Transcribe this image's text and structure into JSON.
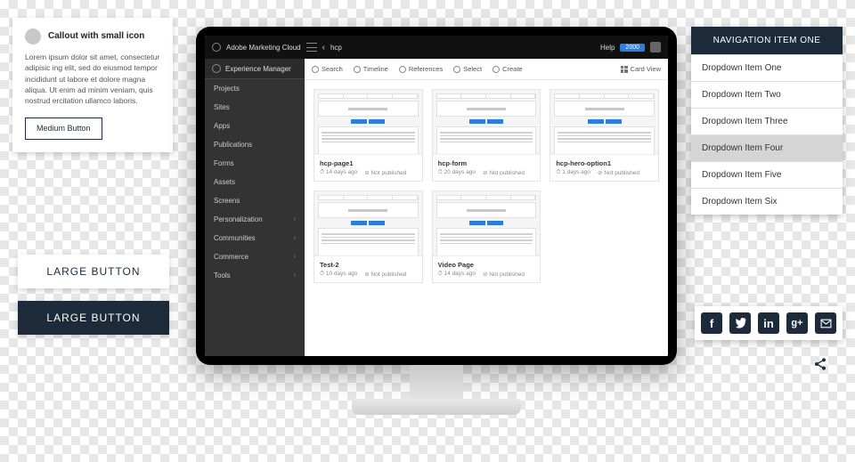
{
  "callout": {
    "title": "Callout with small icon",
    "body": "Lorem ipsum dolor sit amet, consectetur adipisic ing elit, sed do eiusmod tempor incididunt ut labore et dolore magna aliqua. Ut enim ad minim veniam, quis nostrud ercitation ullamco laboris.",
    "button": "Medium Button"
  },
  "large_buttons": {
    "light": "LARGE BUTTON",
    "dark": "LARGE BUTTON"
  },
  "topbar": {
    "brand": "Adobe Marketing Cloud",
    "crumb": "hcp",
    "help": "Help",
    "badge": "2000"
  },
  "sidenav": {
    "brand": "Experience Manager",
    "items": [
      {
        "label": "Projects",
        "expand": false
      },
      {
        "label": "Sites",
        "expand": false
      },
      {
        "label": "Apps",
        "expand": false
      },
      {
        "label": "Publications",
        "expand": false
      },
      {
        "label": "Forms",
        "expand": false
      },
      {
        "label": "Assets",
        "expand": false
      },
      {
        "label": "Screens",
        "expand": false
      },
      {
        "label": "Personalization",
        "expand": true
      },
      {
        "label": "Communities",
        "expand": true
      },
      {
        "label": "Commerce",
        "expand": true
      },
      {
        "label": "Tools",
        "expand": true
      }
    ]
  },
  "toolbar": {
    "items": [
      "Search",
      "Timeline",
      "References",
      "Select",
      "Create"
    ],
    "view": "Card View"
  },
  "cards": [
    {
      "name": "hcp-page1",
      "age": "14 days ago",
      "status": "Not published"
    },
    {
      "name": "hcp-form",
      "age": "20 days ago",
      "status": "Not published"
    },
    {
      "name": "hcp-hero-option1",
      "age": "1 days ago",
      "status": "Not published"
    },
    {
      "name": "Test-2",
      "age": "10 days ago",
      "status": "Not published"
    },
    {
      "name": "Video Page",
      "age": "14 days ago",
      "status": "Not published"
    }
  ],
  "navlist": {
    "head": "NAVIGATION ITEM ONE",
    "items": [
      "Dropdown Item One",
      "Dropdown Item Two",
      "Dropdown Item Three",
      "Dropdown Item Four",
      "Dropdown Item Five",
      "Dropdown Item Six"
    ],
    "selected": 3
  },
  "social": {
    "icons": [
      "facebook",
      "twitter",
      "linkedin",
      "google-plus",
      "email"
    ]
  }
}
